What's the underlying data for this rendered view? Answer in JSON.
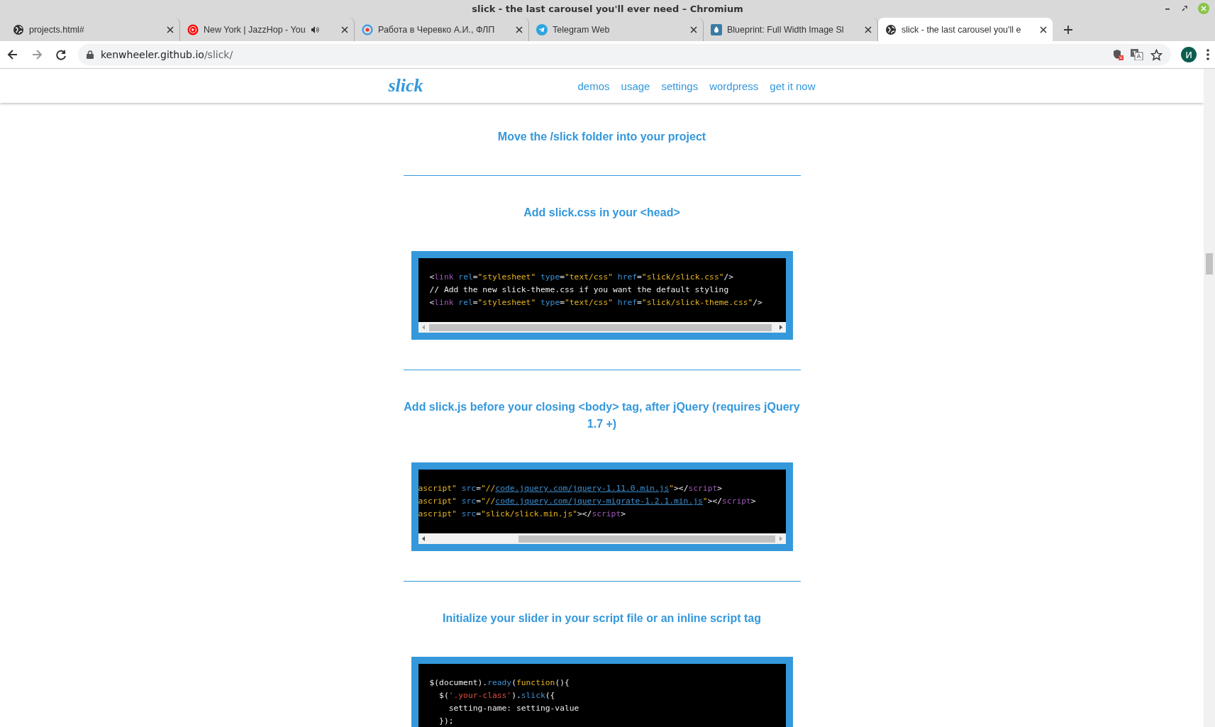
{
  "window": {
    "title": "slick - the last carousel you'll ever need – Chromium"
  },
  "tabs": [
    {
      "title": "projects.html#",
      "kind": "globe",
      "selected": false,
      "audio": false
    },
    {
      "title": "New York | JazzHop - You",
      "kind": "play",
      "selected": false,
      "audio": true
    },
    {
      "title": "Работа в Черевко А.И., ФЛП",
      "kind": "target",
      "selected": false,
      "audio": false
    },
    {
      "title": "Telegram Web",
      "kind": "plane",
      "selected": false,
      "audio": false
    },
    {
      "title": "Blueprint: Full Width Image Sl",
      "kind": "drop",
      "selected": false,
      "audio": false
    },
    {
      "title": "slick - the last carousel you'll e",
      "kind": "globe",
      "selected": true,
      "audio": false
    }
  ],
  "address": {
    "host": "kenwheeler.github.io",
    "path": "/slick/"
  },
  "profile": {
    "initial": "И"
  },
  "site": {
    "logo": "slick",
    "nav": [
      "demos",
      "usage",
      "settings",
      "wordpress",
      "get it now"
    ]
  },
  "sections": [
    {
      "heading": "Move the /slick folder into your project"
    },
    {
      "heading": "Add slick.css in your <head>",
      "code": {
        "scrolled": false,
        "lines": [
          [
            {
              "t": "<",
              "kind": "punct"
            },
            {
              "t": "link",
              "kind": "tag"
            },
            {
              "t": " rel",
              "kind": "attr"
            },
            {
              "t": "=",
              "kind": "punct"
            },
            {
              "t": "\"stylesheet\"",
              "kind": "string"
            },
            {
              "t": " type",
              "kind": "attr"
            },
            {
              "t": "=",
              "kind": "punct"
            },
            {
              "t": "\"text/css\"",
              "kind": "string"
            },
            {
              "t": " href",
              "kind": "attr"
            },
            {
              "t": "=",
              "kind": "punct"
            },
            {
              "t": "\"slick/slick.css\"",
              "kind": "string"
            },
            {
              "t": "/>",
              "kind": "punct"
            }
          ],
          [
            {
              "t": "// Add the new slick-theme.css if you want the default styling",
              "kind": "punct"
            }
          ],
          [
            {
              "t": "<",
              "kind": "punct"
            },
            {
              "t": "link",
              "kind": "tag"
            },
            {
              "t": " rel",
              "kind": "attr"
            },
            {
              "t": "=",
              "kind": "punct"
            },
            {
              "t": "\"stylesheet\"",
              "kind": "string"
            },
            {
              "t": " type",
              "kind": "attr"
            },
            {
              "t": "=",
              "kind": "punct"
            },
            {
              "t": "\"text/css\"",
              "kind": "string"
            },
            {
              "t": " href",
              "kind": "attr"
            },
            {
              "t": "=",
              "kind": "punct"
            },
            {
              "t": "\"slick/slick-theme.css\"",
              "kind": "string"
            },
            {
              "t": "/>",
              "kind": "punct"
            }
          ]
        ]
      }
    },
    {
      "heading": "Add slick.js before your closing <body> tag, after jQuery (requires jQuery 1.7 +)",
      "code": {
        "scrolled": true,
        "lines": [
          [
            {
              "t": "ascript\"",
              "kind": "string"
            },
            {
              "t": " src",
              "kind": "attr"
            },
            {
              "t": "=",
              "kind": "punct"
            },
            {
              "t": "\"//",
              "kind": "string"
            },
            {
              "t": "code.jquery.com/jquery-1.11.0.min.js",
              "kind": "link"
            },
            {
              "t": "\"",
              "kind": "string"
            },
            {
              "t": "></",
              "kind": "punct"
            },
            {
              "t": "script",
              "kind": "tag"
            },
            {
              "t": ">",
              "kind": "punct"
            }
          ],
          [
            {
              "t": "ascript\"",
              "kind": "string"
            },
            {
              "t": " src",
              "kind": "attr"
            },
            {
              "t": "=",
              "kind": "punct"
            },
            {
              "t": "\"//",
              "kind": "string"
            },
            {
              "t": "code.jquery.com/jquery-migrate-1.2.1.min.js",
              "kind": "link"
            },
            {
              "t": "\"",
              "kind": "string"
            },
            {
              "t": "></",
              "kind": "punct"
            },
            {
              "t": "script",
              "kind": "tag"
            },
            {
              "t": ">",
              "kind": "punct"
            }
          ],
          [
            {
              "t": "ascript\"",
              "kind": "string"
            },
            {
              "t": " src",
              "kind": "attr"
            },
            {
              "t": "=",
              "kind": "punct"
            },
            {
              "t": "\"slick/slick.min.js\"",
              "kind": "string"
            },
            {
              "t": "></",
              "kind": "punct"
            },
            {
              "t": "script",
              "kind": "tag"
            },
            {
              "t": ">",
              "kind": "punct"
            }
          ]
        ]
      }
    },
    {
      "heading": "Initialize your slider in your script file or an inline script tag",
      "code": {
        "lines": [
          [
            {
              "t": "$(document).",
              "kind": "punct"
            },
            {
              "t": "ready",
              "kind": "attr"
            },
            {
              "t": "(",
              "kind": "punct"
            },
            {
              "t": "function",
              "kind": "string"
            },
            {
              "t": "(){",
              "kind": "punct"
            }
          ],
          [
            {
              "t": "  $(",
              "kind": "punct"
            },
            {
              "t": "'.your-class'",
              "kind": "red"
            },
            {
              "t": ").",
              "kind": "punct"
            },
            {
              "t": "slick",
              "kind": "attr"
            },
            {
              "t": "({",
              "kind": "punct"
            }
          ],
          [
            {
              "t": "    setting-name: setting-value",
              "kind": "punct"
            }
          ],
          [
            {
              "t": "  });",
              "kind": "punct"
            }
          ]
        ]
      }
    }
  ]
}
